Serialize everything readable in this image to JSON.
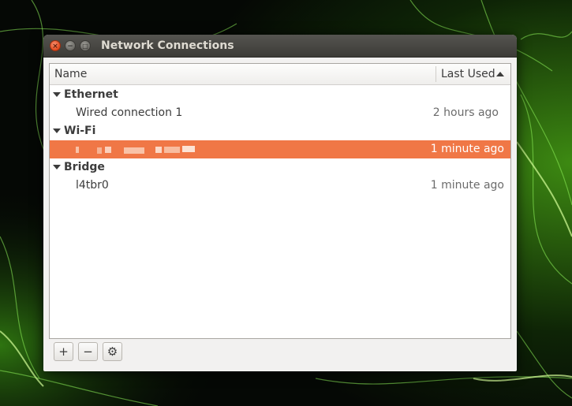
{
  "window": {
    "title": "Network Connections",
    "close_glyph": "×",
    "minimize_glyph": "−",
    "maximize_glyph": "□"
  },
  "columns": {
    "name": "Name",
    "last_used": "Last Used",
    "sort": "ascending"
  },
  "groups": [
    {
      "label": "Ethernet",
      "connections": [
        {
          "name": "Wired connection 1",
          "last_used": "2 hours ago"
        }
      ]
    },
    {
      "label": "Wi-Fi",
      "connections": [
        {
          "name": "",
          "name_obscured": true,
          "last_used": "1 minute ago",
          "selected": true
        }
      ]
    },
    {
      "label": "Bridge",
      "connections": [
        {
          "name": "l4tbr0",
          "last_used": "1 minute ago"
        }
      ]
    }
  ],
  "toolbar": {
    "add_label": "+",
    "remove_label": "−",
    "settings_icon": "gear-icon",
    "settings_glyph": "⚙"
  },
  "colors": {
    "selection": "#f07746",
    "titlebar": "#3c3b37",
    "close_button": "#e1491c"
  }
}
